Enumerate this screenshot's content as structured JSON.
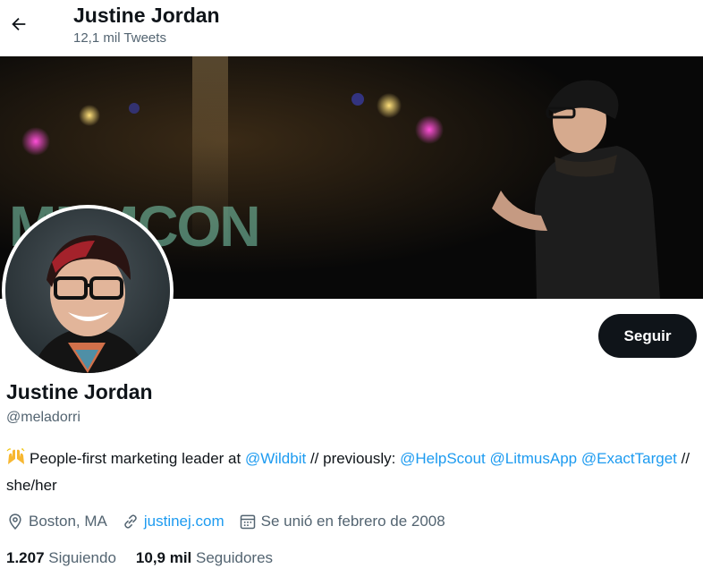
{
  "header": {
    "name": "Justine Jordan",
    "tweet_count": "12,1 mil Tweets"
  },
  "profile": {
    "name": "Justine Jordan",
    "handle": "@meladorri",
    "follow_label": "Seguir"
  },
  "bio": {
    "emoji": "raising-hands",
    "text_1": "People-first marketing leader at ",
    "mention_1": "@Wildbit",
    "text_2": " // previously: ",
    "mention_2": "@HelpScout",
    "mention_3": "@LitmusApp",
    "mention_4": "@ExactTarget",
    "text_3": " // she/her"
  },
  "meta": {
    "location": "Boston, MA",
    "website": "justinej.com",
    "joined": "Se unió en febrero de 2008"
  },
  "stats": {
    "following_count": "1.207",
    "following_label": "Siguiendo",
    "followers_count": "10,9 mil",
    "followers_label": "Seguidores"
  },
  "banner": {
    "sign_text": "MEMCON"
  },
  "colors": {
    "link": "#1d9bf0",
    "text": "#0f1419",
    "secondary": "#536471",
    "button_bg": "#0f1419"
  }
}
